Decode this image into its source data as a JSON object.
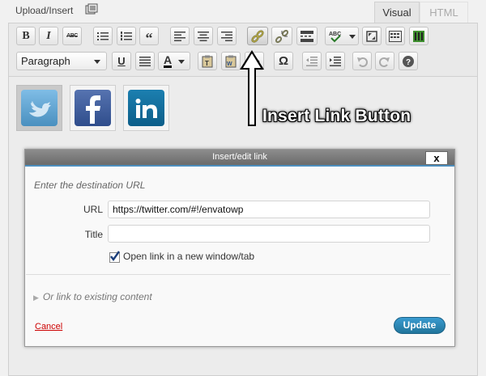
{
  "topbar": {
    "upload_label": "Upload/Insert",
    "tabs": {
      "visual": "Visual",
      "html": "HTML"
    }
  },
  "toolbar": {
    "row1": {
      "bold": "B",
      "italic": "I",
      "strikethrough": "ABC",
      "blockquote": "“"
    },
    "row2": {
      "format_select": "Paragraph",
      "underline": "U",
      "text_color": "A",
      "special_char": "Ω"
    }
  },
  "annotation": {
    "text": "Insert Link Button"
  },
  "dialog": {
    "title": "Insert/edit link",
    "close": "x",
    "hint": "Enter the destination URL",
    "url_label": "URL",
    "url_value": "https://twitter.com/#!/envatowp",
    "title_label": "Title",
    "title_value": "",
    "new_window_label": "Open link in a new window/tab",
    "new_window_checked": true,
    "existing_toggle": "Or link to existing content",
    "cancel": "Cancel",
    "update": "Update"
  },
  "colors": {
    "twitter": "#55acee",
    "facebook": "#3b5998",
    "linkedin": "#0e76a8",
    "update_button": "#21759b",
    "cancel_link": "#cc0000"
  }
}
